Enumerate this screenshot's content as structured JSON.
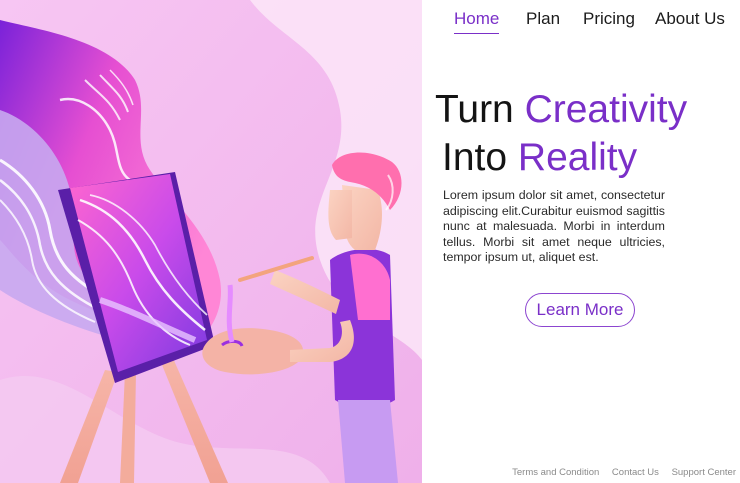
{
  "nav": {
    "items": [
      {
        "label": "Home",
        "active": true
      },
      {
        "label": "Plan",
        "active": false
      },
      {
        "label": "Pricing",
        "active": false
      },
      {
        "label": "About Us",
        "active": false
      }
    ]
  },
  "hero": {
    "title_word_1": "Turn",
    "title_accent_1": "Creativity",
    "title_word_2": "Into",
    "title_accent_2": "Reality",
    "body": "Lorem ipsum dolor sit amet, consectetur adipiscing elit.Curabitur euismod sagittis nunc at malesuada. Morbi in interdum tellus. Morbi sit amet neque ultricies, tempor ipsum ut, aliquet est.",
    "cta_label": "Learn More"
  },
  "footer": {
    "links": [
      "Terms and Condition",
      "Contact Us",
      "Support Center"
    ]
  },
  "colors": {
    "accent": "#7a2fc8",
    "illustration_background": "#f0b8ec",
    "paint_pink": "#ff5fc7",
    "paint_purple": "#8c2fe0"
  }
}
